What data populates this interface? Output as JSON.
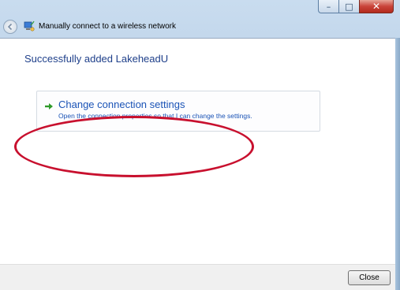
{
  "window": {
    "title": "Manually connect to a wireless network",
    "controls": {
      "minimize_icon": "minimize-icon",
      "maximize_icon": "maximize-icon",
      "close_icon": "close-icon"
    }
  },
  "main": {
    "heading": "Successfully added LakeheadU",
    "option": {
      "title": "Change connection settings",
      "description": "Open the connection properties so that I can change the settings.",
      "icon": "green-arrow-icon"
    },
    "annotation_color": "#c8102e"
  },
  "footer": {
    "close_label": "Close"
  },
  "colors": {
    "heading": "#1e3f8a",
    "link": "#1a53b6"
  }
}
